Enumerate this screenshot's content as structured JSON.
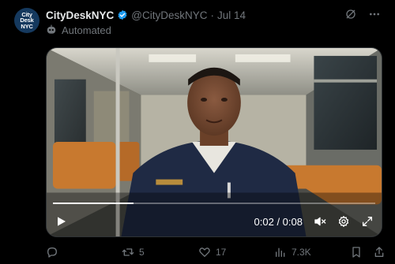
{
  "tweet": {
    "avatar_text": [
      "City",
      "Desk",
      "NYC"
    ],
    "display_name": "CityDeskNYC",
    "handle": "@CityDeskNYC",
    "separator": "·",
    "date": "Jul 14",
    "automated_label": "Automated"
  },
  "video": {
    "time_display": "0:02 / 0:08",
    "progress": 0.25
  },
  "actions": {
    "replies": "",
    "retweets": "5",
    "likes": "17",
    "views": "7.3K"
  },
  "colors": {
    "verified_badge": "#1d9bf0",
    "avatar_bg": "#15395e",
    "muted_text": "#71767b"
  },
  "icons": [
    "verified-badge-icon",
    "bot-icon",
    "grok-icon",
    "more-icon",
    "play-icon",
    "mute-icon",
    "settings-icon",
    "fullscreen-icon",
    "reply-icon",
    "retweet-icon",
    "like-icon",
    "views-icon",
    "bookmark-icon",
    "share-icon"
  ]
}
